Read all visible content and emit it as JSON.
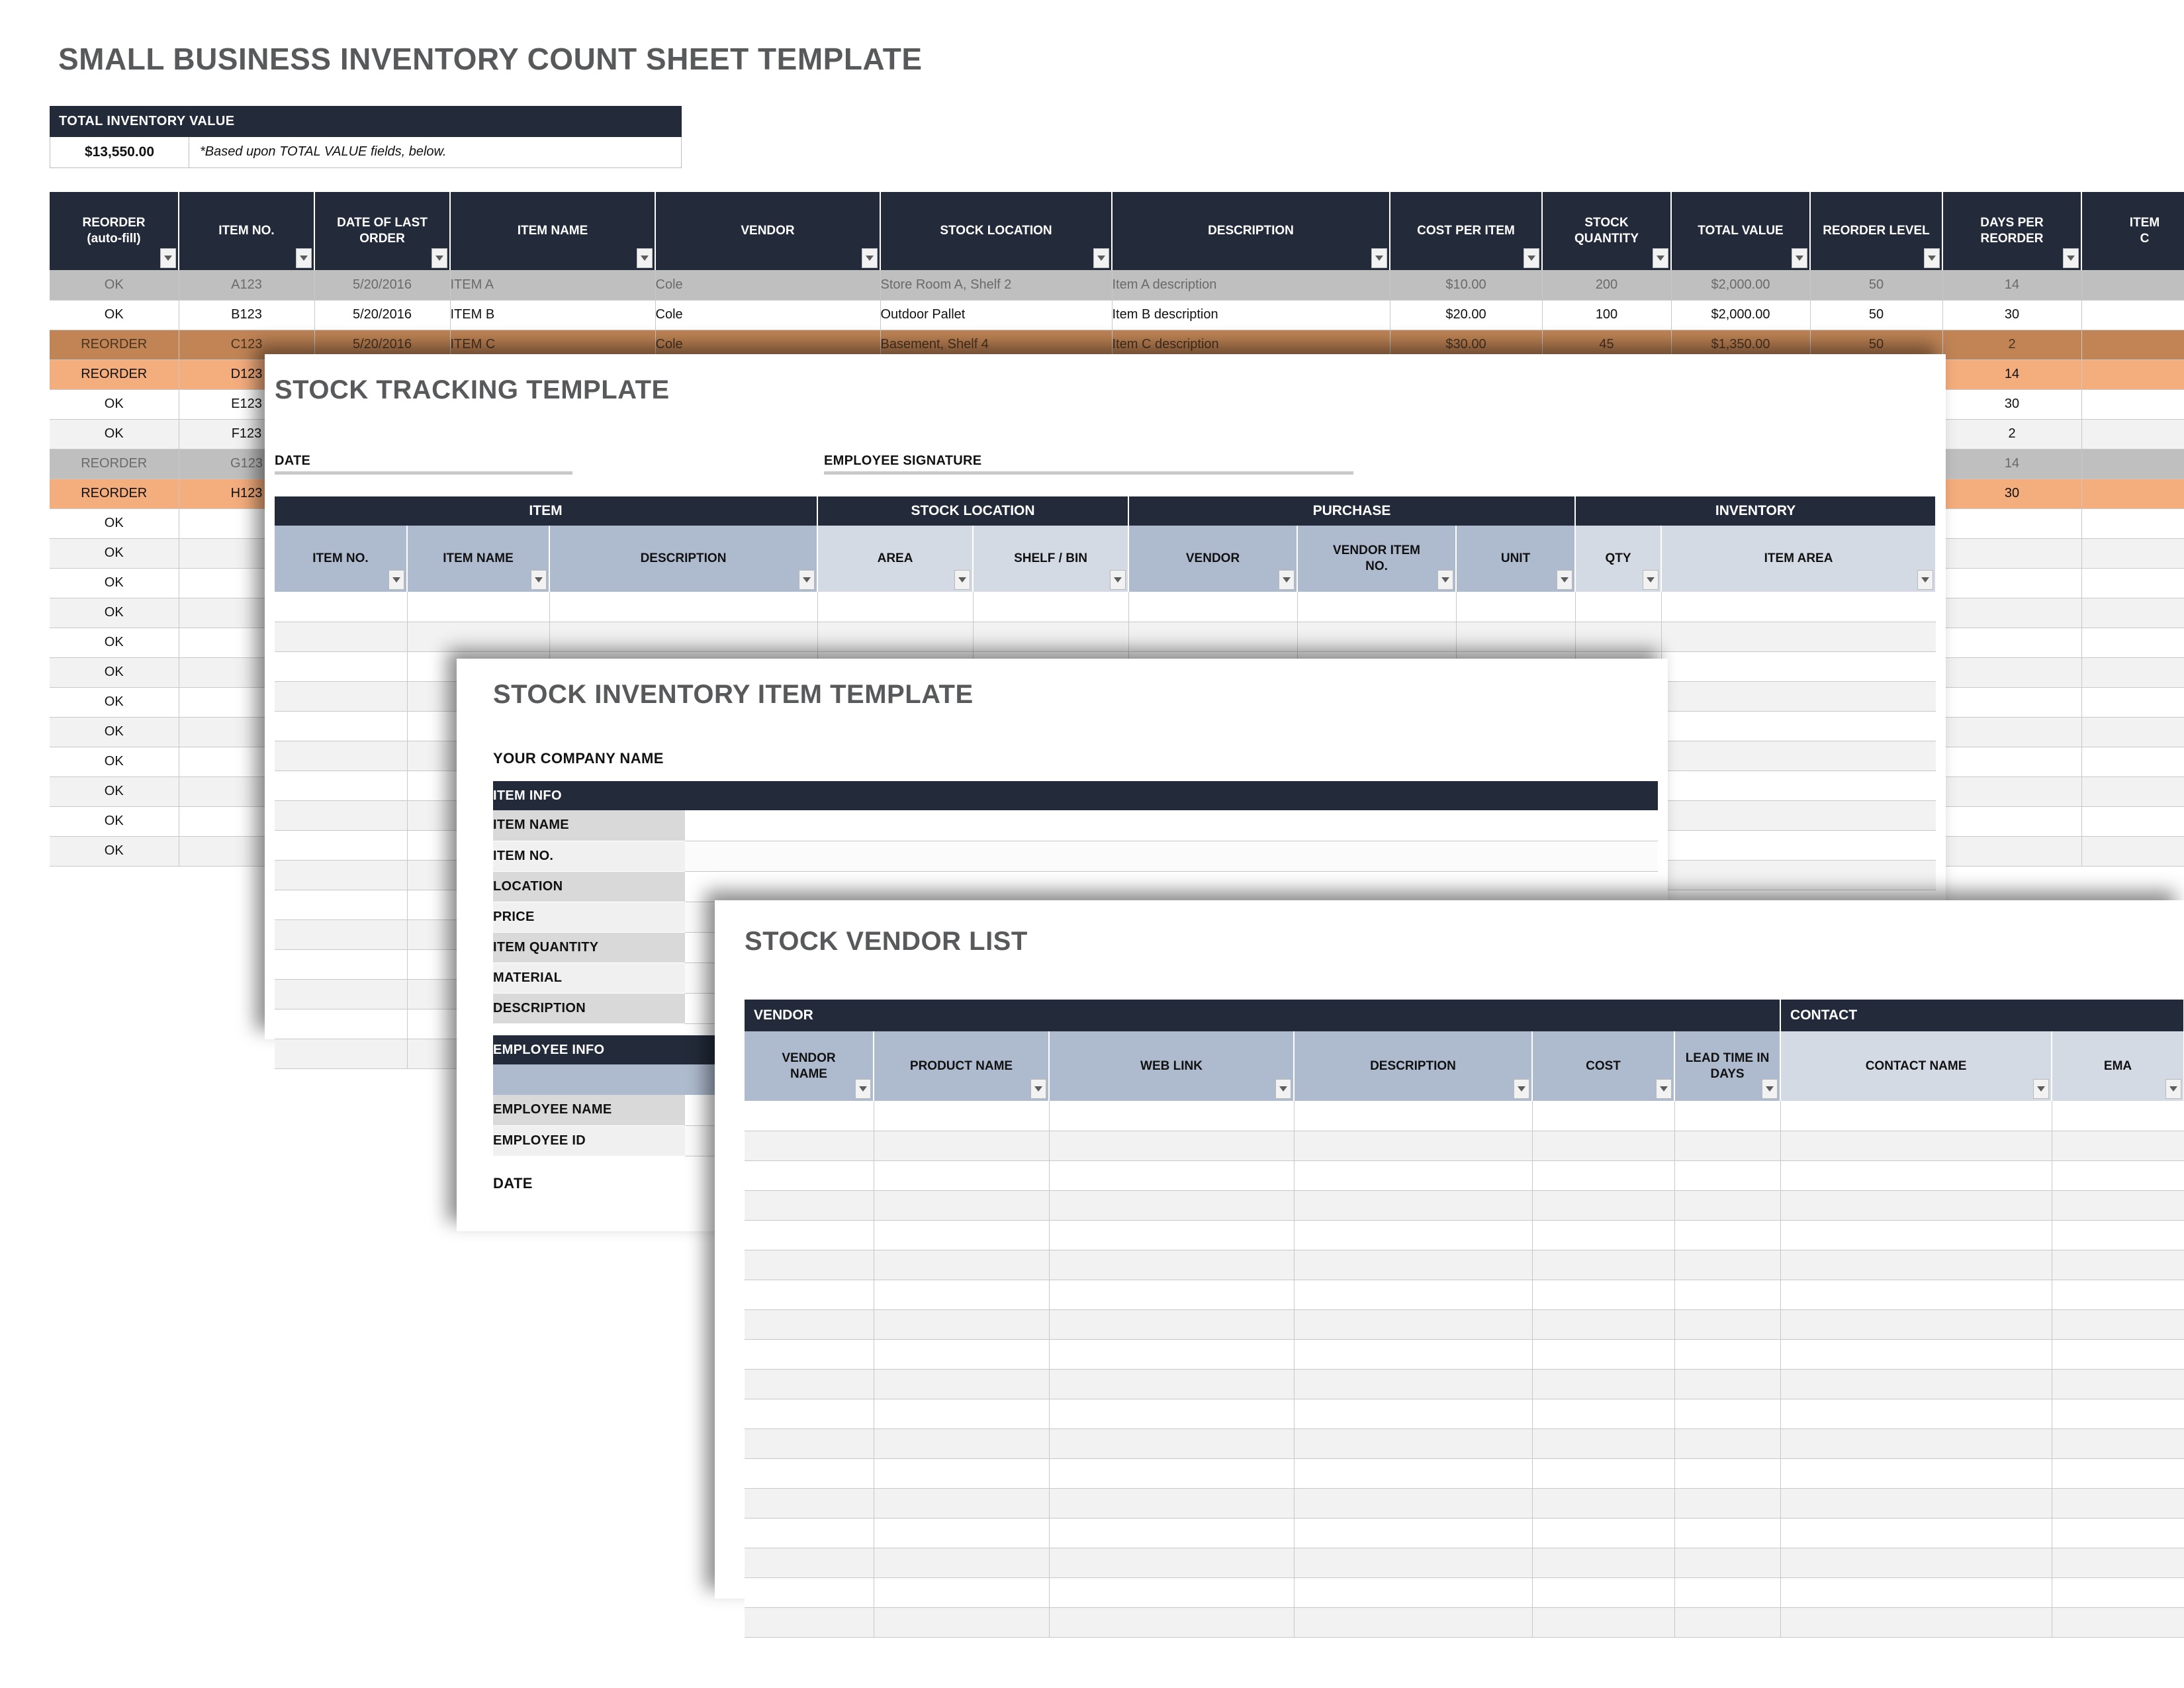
{
  "page": {
    "background": "#ffffff",
    "accent_dark": "#232b3a",
    "accent_blue": "#aebbce",
    "accent_blue_light": "#d3dae3",
    "accent_orange": "#f4ad7d",
    "title_color": "#58595b"
  },
  "inventory_sheet": {
    "title": "SMALL BUSINESS INVENTORY COUNT SHEET TEMPLATE",
    "total_box": {
      "header": "TOTAL INVENTORY VALUE",
      "value": "$13,550.00",
      "note": "*Based upon TOTAL VALUE fields, below."
    },
    "columns": [
      "REORDER\n(auto-fill)",
      "ITEM NO.",
      "DATE OF LAST\nORDER",
      "ITEM NAME",
      "VENDOR",
      "STOCK LOCATION",
      "DESCRIPTION",
      "COST PER ITEM",
      "STOCK\nQUANTITY",
      "TOTAL VALUE",
      "REORDER LEVEL",
      "DAYS PER\nREORDER",
      "ITEM\nC"
    ],
    "rows": [
      {
        "style": "selected",
        "cells": [
          "OK",
          "A123",
          "5/20/2016",
          "ITEM A",
          "Cole",
          "Store Room A, Shelf 2",
          "Item A description",
          "$10.00",
          "200",
          "$2,000.00",
          "50",
          "14",
          ""
        ]
      },
      {
        "style": "white",
        "cells": [
          "OK",
          "B123",
          "5/20/2016",
          "ITEM B",
          "Cole",
          "Outdoor Pallet",
          "Item B description",
          "$20.00",
          "100",
          "$2,000.00",
          "50",
          "30",
          ""
        ]
      },
      {
        "style": "orange-sel",
        "cells": [
          "REORDER",
          "C123",
          "5/20/2016",
          "ITEM C",
          "Cole",
          "Basement, Shelf 4",
          "Item C description",
          "$30.00",
          "45",
          "$1,350.00",
          "50",
          "2",
          ""
        ]
      },
      {
        "style": "orange",
        "cells": [
          "REORDER",
          "D123",
          "",
          "",
          "",
          "",
          "",
          "",
          "",
          "",
          "",
          "14",
          ""
        ]
      },
      {
        "style": "white",
        "cells": [
          "OK",
          "E123",
          "",
          "",
          "",
          "",
          "",
          "",
          "",
          "",
          "",
          "30",
          ""
        ]
      },
      {
        "style": "gray",
        "cells": [
          "OK",
          "F123",
          "",
          "",
          "",
          "",
          "",
          "",
          "",
          "",
          "",
          "2",
          ""
        ]
      },
      {
        "style": "selected",
        "cells": [
          "REORDER",
          "G123",
          "",
          "",
          "",
          "",
          "",
          "",
          "",
          "",
          "",
          "14",
          ""
        ]
      },
      {
        "style": "orange",
        "cells": [
          "REORDER",
          "H123",
          "",
          "",
          "",
          "",
          "",
          "",
          "",
          "",
          "",
          "30",
          ""
        ]
      },
      {
        "style": "white",
        "cells": [
          "OK",
          "",
          "",
          "",
          "",
          "",
          "",
          "",
          "",
          "",
          "",
          "",
          ""
        ]
      },
      {
        "style": "gray",
        "cells": [
          "OK",
          "",
          "",
          "",
          "",
          "",
          "",
          "",
          "",
          "",
          "",
          "",
          ""
        ]
      },
      {
        "style": "white",
        "cells": [
          "OK",
          "",
          "",
          "",
          "",
          "",
          "",
          "",
          "",
          "",
          "",
          "",
          ""
        ]
      },
      {
        "style": "gray",
        "cells": [
          "OK",
          "",
          "",
          "",
          "",
          "",
          "",
          "",
          "",
          "",
          "",
          "",
          ""
        ]
      },
      {
        "style": "white",
        "cells": [
          "OK",
          "",
          "",
          "",
          "",
          "",
          "",
          "",
          "",
          "",
          "",
          "",
          ""
        ]
      },
      {
        "style": "gray",
        "cells": [
          "OK",
          "",
          "",
          "",
          "",
          "",
          "",
          "",
          "",
          "",
          "",
          "",
          ""
        ]
      },
      {
        "style": "white",
        "cells": [
          "OK",
          "",
          "",
          "",
          "",
          "",
          "",
          "",
          "",
          "",
          "",
          "",
          ""
        ]
      },
      {
        "style": "gray",
        "cells": [
          "OK",
          "",
          "",
          "",
          "",
          "",
          "",
          "",
          "",
          "",
          "",
          "",
          ""
        ]
      },
      {
        "style": "white",
        "cells": [
          "OK",
          "",
          "",
          "",
          "",
          "",
          "",
          "",
          "",
          "",
          "",
          "",
          ""
        ]
      },
      {
        "style": "gray",
        "cells": [
          "OK",
          "",
          "",
          "",
          "",
          "",
          "",
          "",
          "",
          "",
          "",
          "",
          ""
        ]
      },
      {
        "style": "white",
        "cells": [
          "OK",
          "",
          "",
          "",
          "",
          "",
          "",
          "",
          "",
          "",
          "",
          "",
          ""
        ]
      },
      {
        "style": "gray",
        "cells": [
          "OK",
          "",
          "",
          "",
          "",
          "",
          "",
          "",
          "",
          "",
          "",
          "",
          ""
        ]
      }
    ]
  },
  "stock_tracking": {
    "title": "STOCK TRACKING TEMPLATE",
    "date_label": "DATE",
    "signature_label": "EMPLOYEE SIGNATURE",
    "groups": [
      {
        "label": "ITEM",
        "span": 3
      },
      {
        "label": "STOCK LOCATION",
        "span": 2
      },
      {
        "label": "PURCHASE",
        "span": 3
      },
      {
        "label": "INVENTORY",
        "span": 2
      }
    ],
    "columns": [
      {
        "label": "ITEM NO.",
        "tone": "blue"
      },
      {
        "label": "ITEM NAME",
        "tone": "blue"
      },
      {
        "label": "DESCRIPTION",
        "tone": "blue"
      },
      {
        "label": "AREA",
        "tone": "blue-light"
      },
      {
        "label": "SHELF / BIN",
        "tone": "blue-light"
      },
      {
        "label": "VENDOR",
        "tone": "blue"
      },
      {
        "label": "VENDOR ITEM\nNO.",
        "tone": "blue"
      },
      {
        "label": "UNIT",
        "tone": "blue"
      },
      {
        "label": "QTY",
        "tone": "blue-light"
      },
      {
        "label": "ITEM AREA",
        "tone": "blue-light"
      }
    ],
    "empty_row_count": 16
  },
  "stock_inventory_item": {
    "title": "STOCK INVENTORY ITEM TEMPLATE",
    "company_label": "YOUR COMPANY NAME",
    "item_info_header": "ITEM INFO",
    "item_info_fields": [
      "ITEM NAME",
      "ITEM NO.",
      "LOCATION",
      "PRICE",
      "ITEM QUANTITY",
      "MATERIAL",
      "DESCRIPTION"
    ],
    "employee_info_header": "EMPLOYEE INFO",
    "employee_info_fields": [
      "EMPLOYEE NAME",
      "EMPLOYEE ID"
    ],
    "date_label": "DATE"
  },
  "stock_vendor_list": {
    "title": "STOCK VENDOR LIST",
    "groups": [
      {
        "label": "VENDOR",
        "span": 6
      },
      {
        "label": "CONTACT",
        "span": 2
      }
    ],
    "columns": [
      {
        "label": "VENDOR\nNAME",
        "tone": "blue"
      },
      {
        "label": "PRODUCT NAME",
        "tone": "blue"
      },
      {
        "label": "WEB LINK",
        "tone": "blue"
      },
      {
        "label": "DESCRIPTION",
        "tone": "blue"
      },
      {
        "label": "COST",
        "tone": "blue"
      },
      {
        "label": "LEAD TIME IN\nDAYS",
        "tone": "blue"
      },
      {
        "label": "CONTACT NAME",
        "tone": "blue-light"
      },
      {
        "label": "EMA",
        "tone": "blue-light"
      }
    ],
    "empty_row_count": 18
  }
}
